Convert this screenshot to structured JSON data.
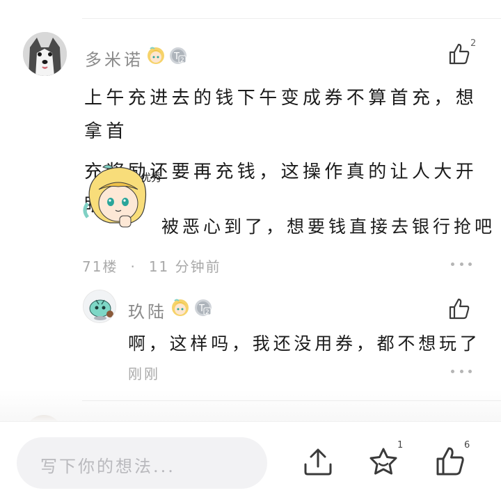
{
  "comment": {
    "username": "多米诺",
    "like_count": "2",
    "lines": [
      "上午充进去的钱下午变成券不算首充，想拿首",
      "充奖励还要再充钱，这操作真的让人大开眼界"
    ],
    "sticker_label": "优秀",
    "sticker_caption": "被恶心到了，想要钱直接去银行抢吧",
    "floor": "71楼",
    "dot": "·",
    "time": "11 分钟前",
    "level_badge": "T2"
  },
  "reply": {
    "username": "玖陆",
    "text": "啊，这样吗，我还没用券，都不想玩了",
    "time": "刚刚",
    "level_badge": "T2"
  },
  "bottom_bar": {
    "input_placeholder": "写下你的想法...",
    "favorite_count": "1",
    "like_count": "6"
  },
  "colors": {
    "muted_text": "#a9a9a9",
    "username": "#8a8a8a",
    "input_bg": "#f2f2f4",
    "icon_stroke": "#3a3a3a"
  }
}
